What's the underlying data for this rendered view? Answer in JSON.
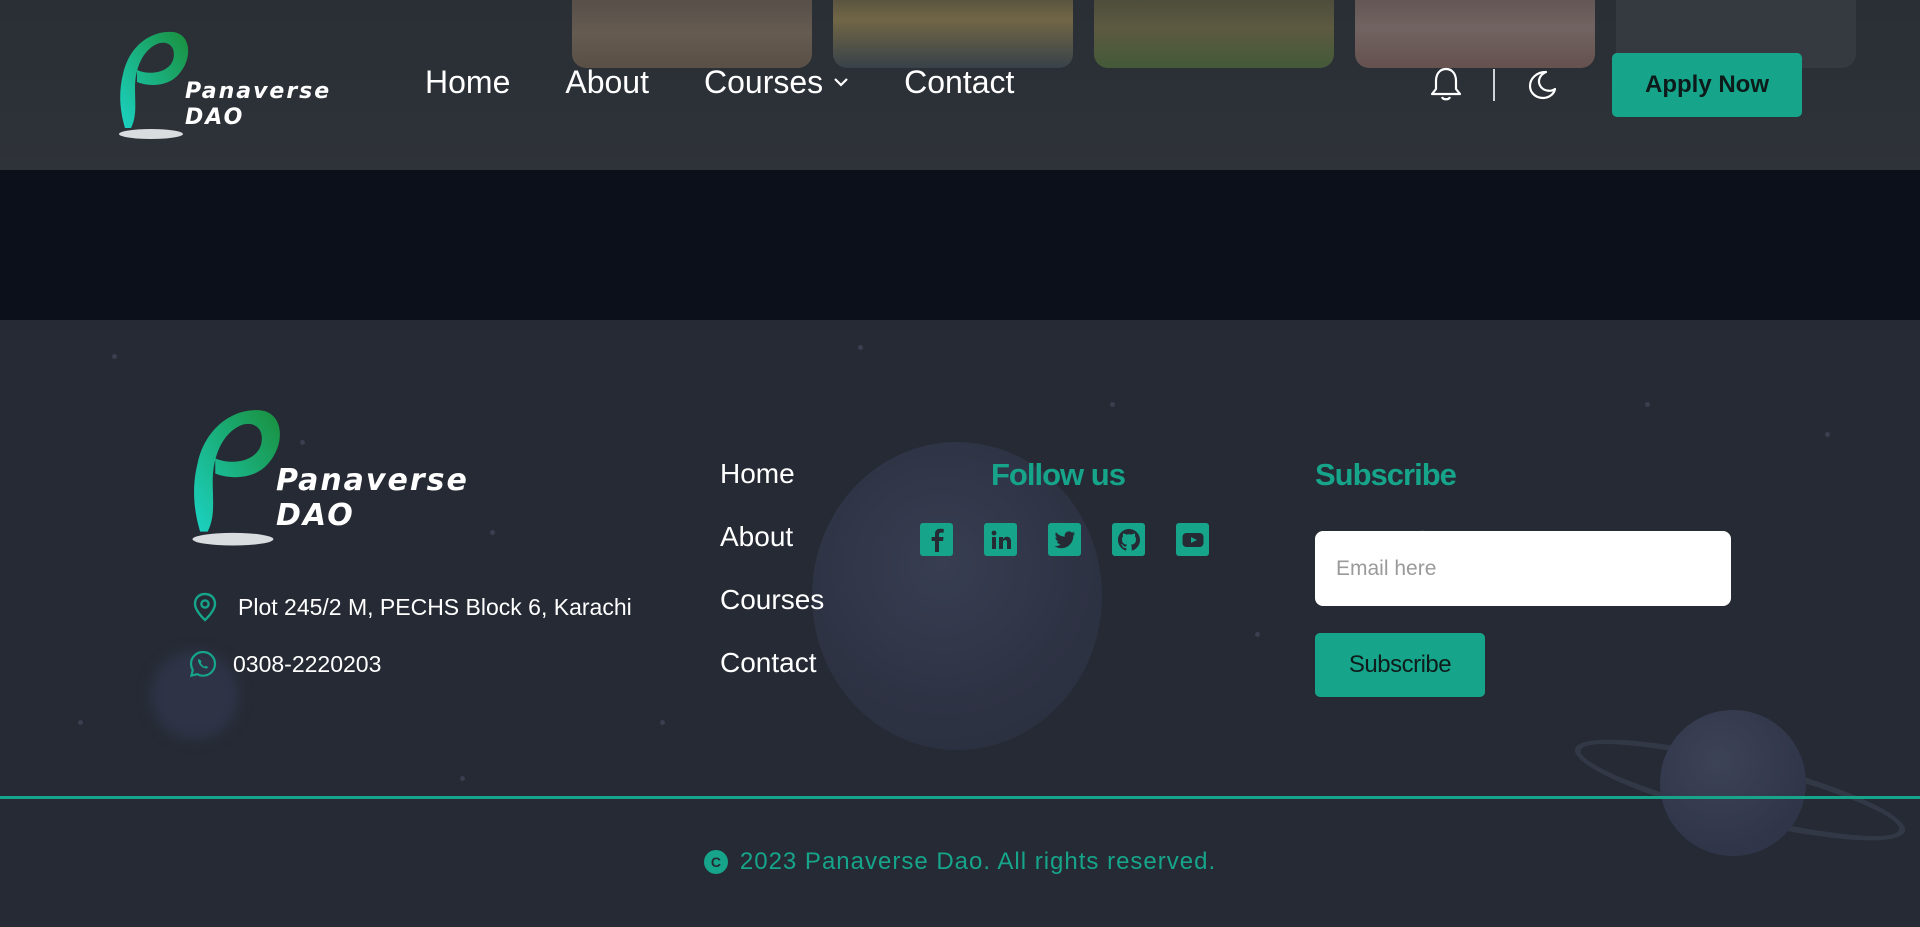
{
  "header": {
    "logo_line1": "Panaverse",
    "logo_line2": "DAO",
    "nav": [
      {
        "label": "Home"
      },
      {
        "label": "About"
      },
      {
        "label": "Courses"
      },
      {
        "label": "Contact"
      }
    ],
    "courses_chevron": "⌄",
    "apply_label": "Apply Now"
  },
  "footer": {
    "logo_line1": "Panaverse",
    "logo_line2": "DAO",
    "address": "Plot 245/2 M, PECHS Block 6, Karachi",
    "phone": "0308-2220203",
    "links": [
      "Home",
      "About",
      "Courses",
      "Contact"
    ],
    "follow_title": "Follow us",
    "socials": [
      "facebook-icon",
      "linkedin-icon",
      "twitter-icon",
      "github-icon",
      "youtube-icon"
    ],
    "subscribe_title": "Subscribe",
    "email_placeholder": "Email here",
    "subscribe_button": "Subscribe",
    "copyright_symbol": "C",
    "copyright": "2023 Panaverse Dao. All rights reserved."
  },
  "colors": {
    "accent": "#16a58a",
    "header_bg": "#2f3439",
    "band_bg": "#0b101b",
    "footer_bg": "#252a34"
  }
}
